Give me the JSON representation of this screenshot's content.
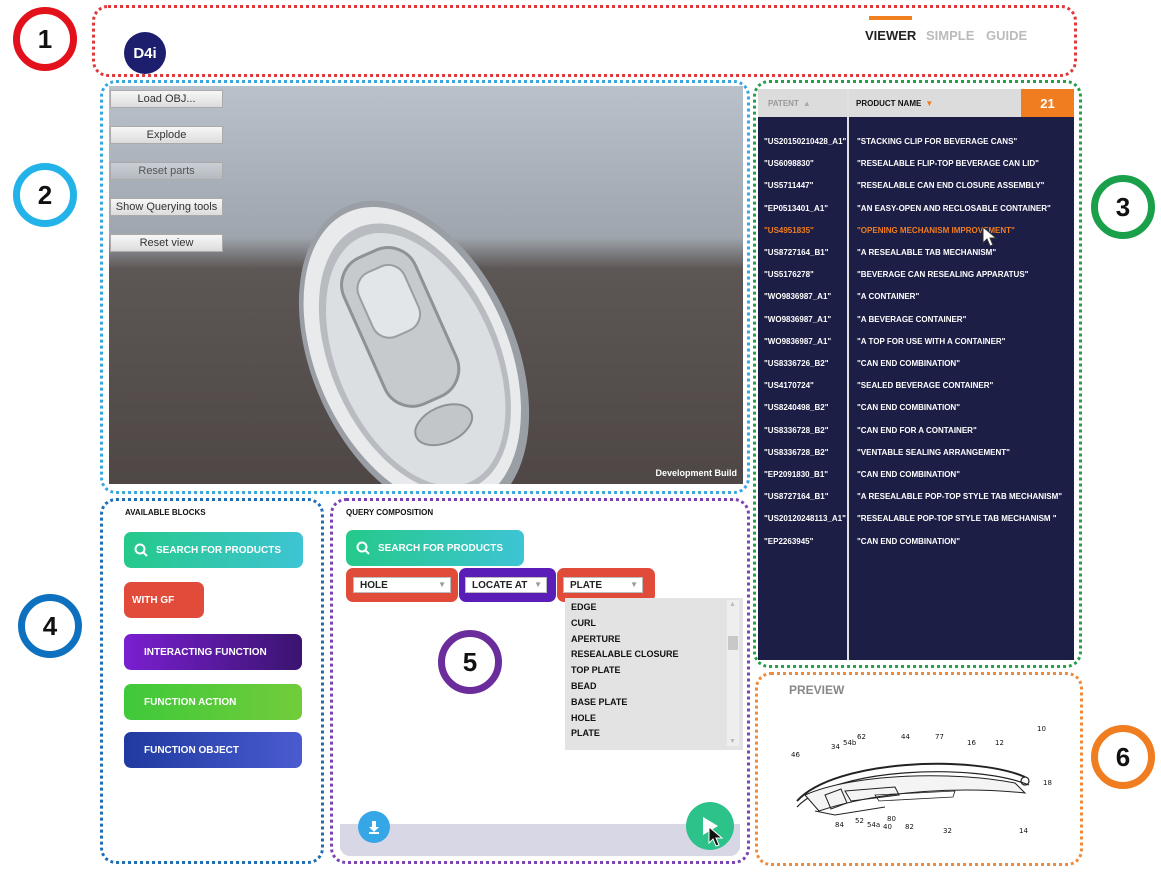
{
  "header": {
    "logo": "D4i",
    "nav": [
      {
        "label": "VIEWER",
        "active": true
      },
      {
        "label": "SIMPLE",
        "active": false
      },
      {
        "label": "GUIDE",
        "active": false
      }
    ]
  },
  "markers": [
    "1",
    "2",
    "3",
    "4",
    "5",
    "6"
  ],
  "viewer": {
    "buttons": [
      "Load OBJ...",
      "Explode",
      "Reset parts",
      "Show Querying tools",
      "Reset view"
    ],
    "build_label": "Development Build"
  },
  "patents": {
    "col_patent": "PATENT",
    "col_product": "PRODUCT NAME",
    "count": "21",
    "rows": [
      {
        "patent": "\"US20150210428_A1\"",
        "name": "\"STACKING CLIP FOR BEVERAGE CANS\""
      },
      {
        "patent": "\"US6098830\"",
        "name": "\"RESEALABLE FLIP-TOP BEVERAGE CAN LID\""
      },
      {
        "patent": "\"US5711447\"",
        "name": "\"RESEALABLE CAN END CLOSURE ASSEMBLY\""
      },
      {
        "patent": "\"EP0513401_A1\"",
        "name": "\"AN EASY-OPEN AND RECLOSABLE CONTAINER\""
      },
      {
        "patent": "\"US4951835\"",
        "name": "\"OPENING MECHANISM IMPROVEMENT\"",
        "highlight": true
      },
      {
        "patent": "\"US8727164_B1\"",
        "name": "\"A RESEALABLE TAB MECHANISM\""
      },
      {
        "patent": "\"US5176278\"",
        "name": "\"BEVERAGE CAN RESEALING APPARATUS\""
      },
      {
        "patent": "\"WO9836987_A1\"",
        "name": "\"A CONTAINER\""
      },
      {
        "patent": "\"WO9836987_A1\"",
        "name": "\"A BEVERAGE CONTAINER\""
      },
      {
        "patent": "\"WO9836987_A1\"",
        "name": "\"A TOP FOR USE WITH A CONTAINER\""
      },
      {
        "patent": "\"US8336726_B2\"",
        "name": "\"CAN END COMBINATION\""
      },
      {
        "patent": "\"US4170724\"",
        "name": "\"SEALED BEVERAGE CONTAINER\""
      },
      {
        "patent": "\"US8240498_B2\"",
        "name": "\"CAN END COMBINATION\""
      },
      {
        "patent": "\"US8336728_B2\"",
        "name": "\"CAN END FOR A CONTAINER\""
      },
      {
        "patent": "\"US8336728_B2\"",
        "name": "\"VENTABLE SEALING ARRANGEMENT\""
      },
      {
        "patent": "\"EP2091830_B1\"",
        "name": "\"CAN END COMBINATION\""
      },
      {
        "patent": "\"US8727164_B1\"",
        "name": "\"A RESEALABLE POP-TOP STYLE TAB MECHANISM\""
      },
      {
        "patent": "\"US20120248113_A1\"",
        "name": "\"RESEALABLE POP-TOP STYLE TAB MECHANISM \""
      },
      {
        "patent": "\"EP2263945\"",
        "name": "\"CAN END COMBINATION\""
      }
    ]
  },
  "blocks": {
    "title": "AVAILABLE BLOCKS",
    "items": [
      "SEARCH FOR PRODUCTS",
      "WITH GF",
      "INTERACTING FUNCTION",
      "FUNCTION ACTION",
      "FUNCTION OBJECT"
    ]
  },
  "query": {
    "title": "QUERY COMPOSITION",
    "search_block": "SEARCH FOR PRODUCTS",
    "selects": [
      "HOLE",
      "LOCATE AT",
      "PLATE"
    ],
    "dropdown_options": [
      "EDGE",
      "CURL",
      "APERTURE",
      "RESEALABLE CLOSURE",
      "TOP PLATE",
      "BEAD",
      "BASE PLATE",
      "HOLE",
      "PLATE"
    ]
  },
  "preview": {
    "title": "PREVIEW",
    "figure_labels": [
      "10",
      "46",
      "34",
      "54b",
      "62",
      "44",
      "77",
      "16",
      "12",
      "18",
      "84",
      "52",
      "54a",
      "80",
      "40",
      "82",
      "32",
      "14"
    ]
  },
  "colors": {
    "accent": "#f07d20",
    "list_bg": "#1c1e45",
    "logo_bg": "#1d1f6e"
  }
}
